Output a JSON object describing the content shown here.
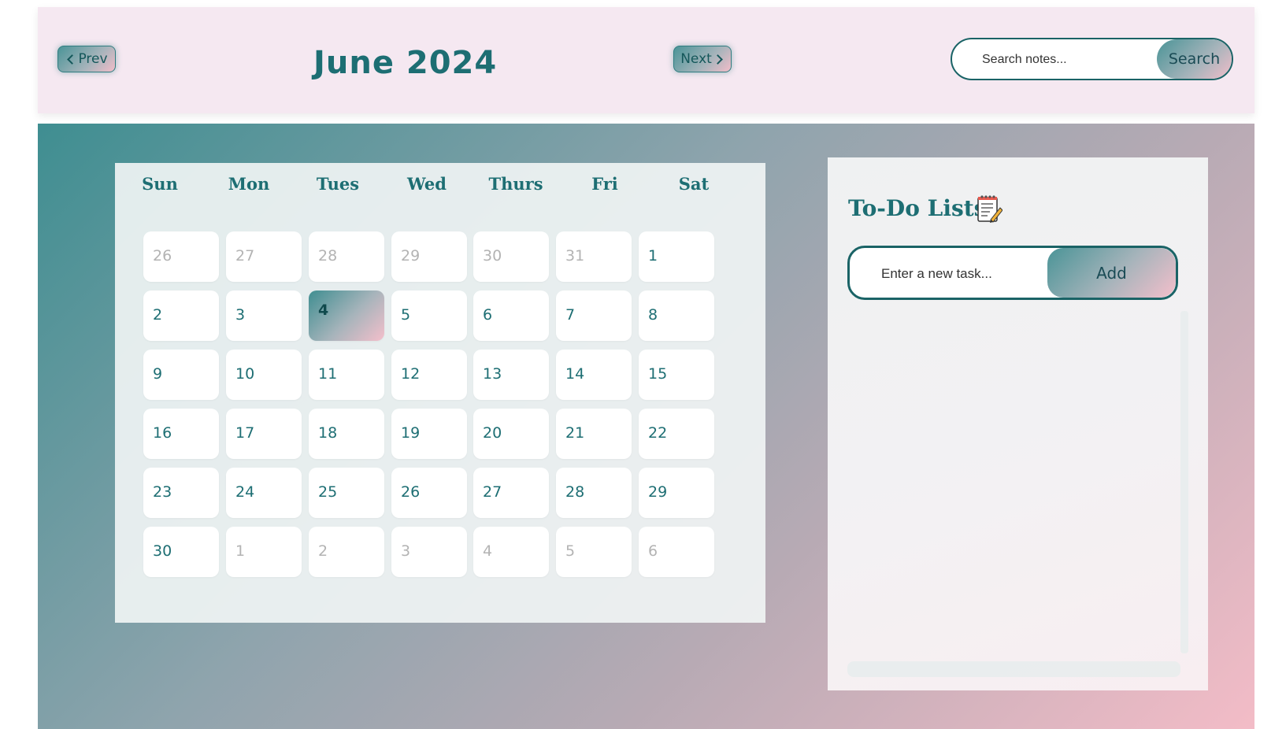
{
  "header": {
    "prev_label": "Prev",
    "next_label": "Next",
    "month_title": "June 2024",
    "search_placeholder": "Search notes...",
    "search_label": "Search"
  },
  "calendar": {
    "weekdays": [
      "Sun",
      "Mon",
      "Tues",
      "Wed",
      "Thurs",
      "Fri",
      "Sat"
    ],
    "weeks": [
      [
        {
          "d": "26",
          "m": true
        },
        {
          "d": "27",
          "m": true
        },
        {
          "d": "28",
          "m": true
        },
        {
          "d": "29",
          "m": true
        },
        {
          "d": "30",
          "m": true
        },
        {
          "d": "31",
          "m": true
        },
        {
          "d": "1",
          "m": false
        }
      ],
      [
        {
          "d": "2",
          "m": false
        },
        {
          "d": "3",
          "m": false
        },
        {
          "d": "4",
          "m": false,
          "today": true
        },
        {
          "d": "5",
          "m": false
        },
        {
          "d": "6",
          "m": false
        },
        {
          "d": "7",
          "m": false
        },
        {
          "d": "8",
          "m": false
        }
      ],
      [
        {
          "d": "9",
          "m": false
        },
        {
          "d": "10",
          "m": false
        },
        {
          "d": "11",
          "m": false
        },
        {
          "d": "12",
          "m": false
        },
        {
          "d": "13",
          "m": false
        },
        {
          "d": "14",
          "m": false
        },
        {
          "d": "15",
          "m": false
        }
      ],
      [
        {
          "d": "16",
          "m": false
        },
        {
          "d": "17",
          "m": false
        },
        {
          "d": "18",
          "m": false
        },
        {
          "d": "19",
          "m": false
        },
        {
          "d": "20",
          "m": false
        },
        {
          "d": "21",
          "m": false
        },
        {
          "d": "22",
          "m": false
        }
      ],
      [
        {
          "d": "23",
          "m": false
        },
        {
          "d": "24",
          "m": false
        },
        {
          "d": "25",
          "m": false
        },
        {
          "d": "26",
          "m": false
        },
        {
          "d": "27",
          "m": false
        },
        {
          "d": "28",
          "m": false
        },
        {
          "d": "29",
          "m": false
        }
      ],
      [
        {
          "d": "30",
          "m": false
        },
        {
          "d": "1",
          "m": true
        },
        {
          "d": "2",
          "m": true
        },
        {
          "d": "3",
          "m": true
        },
        {
          "d": "4",
          "m": true
        },
        {
          "d": "5",
          "m": true
        },
        {
          "d": "6",
          "m": true
        }
      ]
    ]
  },
  "todo": {
    "title": "To-Do Lists",
    "title_icon": "notepad-pencil-icon",
    "input_placeholder": "Enter a new task...",
    "add_label": "Add",
    "items": []
  },
  "colors": {
    "accent": "#1d6e73",
    "header_bg": "#f5e8f1",
    "gradient_start": "#3f8e91",
    "gradient_end": "#f3bcc7",
    "muted_day": "#b3b3b3"
  }
}
